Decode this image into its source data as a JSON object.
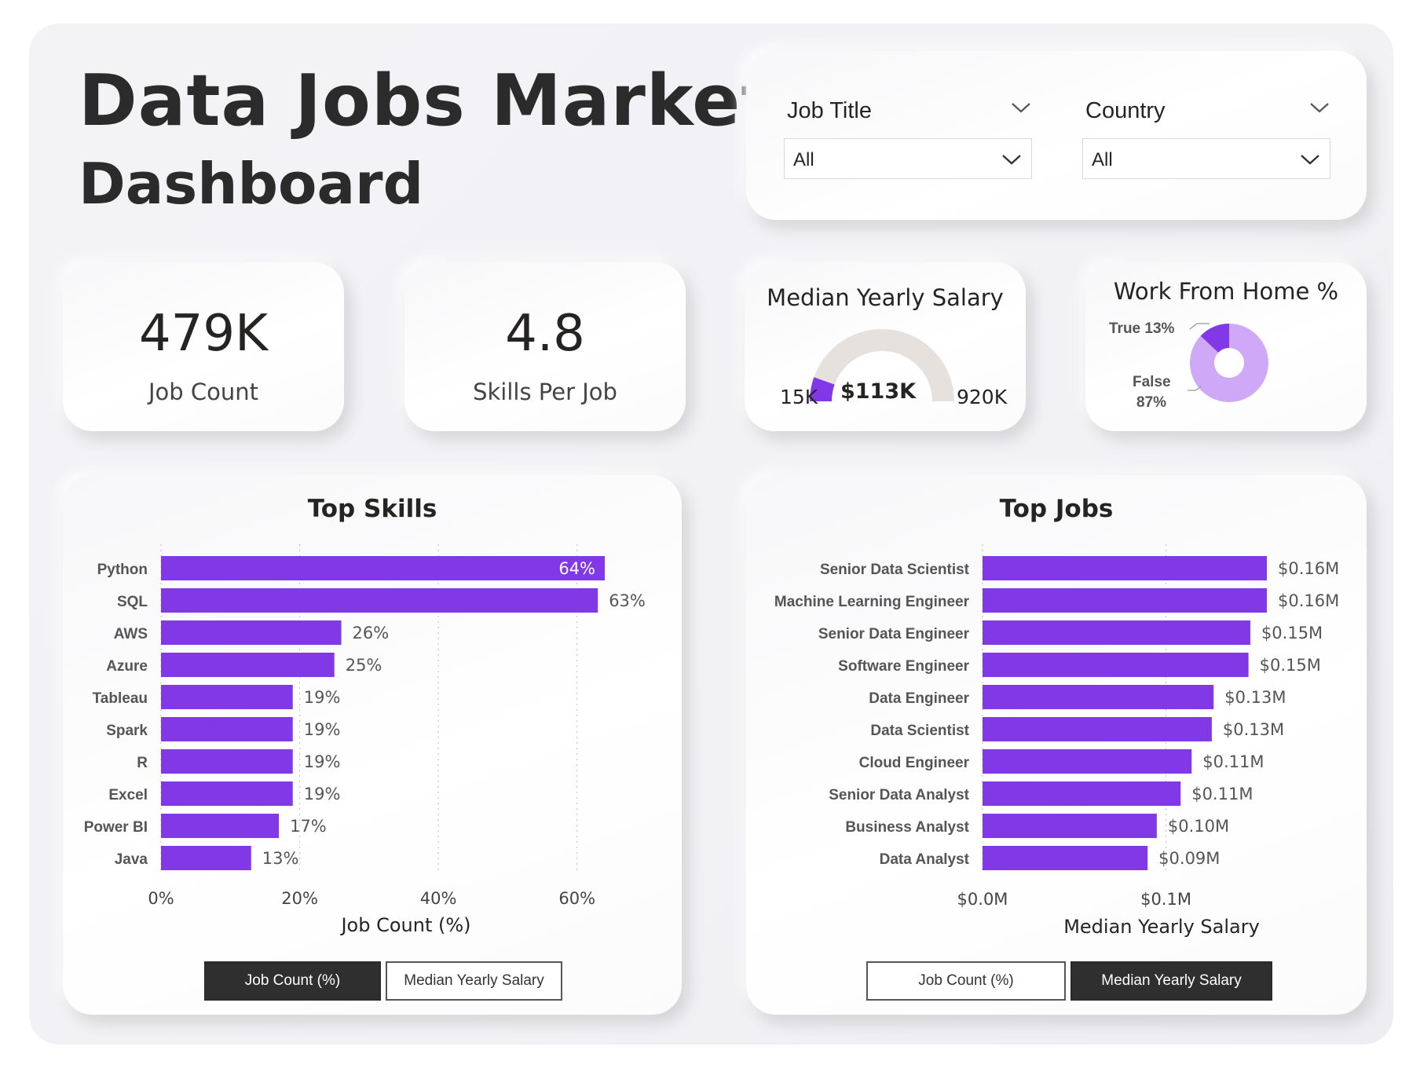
{
  "header": {
    "title_line1": "Data Jobs Market",
    "title_line2": "Dashboard"
  },
  "slicers": [
    {
      "label": "Job Title",
      "value": "All"
    },
    {
      "label": "Country",
      "value": "All"
    }
  ],
  "kpis": {
    "job_count": {
      "value": "479K",
      "label": "Job Count"
    },
    "skills_per_job": {
      "value": "4.8",
      "label": "Skills Per Job"
    }
  },
  "gauge": {
    "title": "Median Yearly Salary",
    "min_label": "15K",
    "max_label": "920K",
    "value_label": "$113K",
    "min": 15,
    "max": 920,
    "value": 113,
    "track_color": "#e6e1dd",
    "fill_color": "#8139e8"
  },
  "wfh": {
    "title": "Work From Home %",
    "true_label": "True 13%",
    "false_label_1": "False",
    "false_label_2": "87%",
    "true_pct": 13,
    "false_pct": 87,
    "true_color": "#8139e8",
    "false_color": "#cfa9f7"
  },
  "colors": {
    "bar": "#8139e8",
    "grid": "#c8c8c8",
    "text": "#252423"
  },
  "top_skills": {
    "title": "Top Skills",
    "toggle_on": "Job Count (%)",
    "toggle_off": "Median Yearly Salary",
    "chart_data": {
      "type": "bar",
      "orientation": "horizontal",
      "categories": [
        "Python",
        "SQL",
        "AWS",
        "Azure",
        "Tableau",
        "Spark",
        "R",
        "Excel",
        "Power BI",
        "Java"
      ],
      "values": [
        64,
        63,
        26,
        25,
        19,
        19,
        19,
        19,
        17,
        13
      ],
      "value_labels": [
        "64%",
        "63%",
        "26%",
        "25%",
        "19%",
        "19%",
        "19%",
        "19%",
        "17%",
        "13%"
      ],
      "xlabel": "Job Count (%)",
      "xlim": [
        0,
        70
      ],
      "xticks": [
        0,
        20,
        40,
        60
      ],
      "xtick_labels": [
        "0%",
        "20%",
        "40%",
        "60%"
      ],
      "grid": true
    }
  },
  "top_jobs": {
    "title": "Top Jobs",
    "toggle_off": "Job Count (%)",
    "toggle_on": "Median Yearly Salary",
    "chart_data": {
      "type": "bar",
      "orientation": "horizontal",
      "categories": [
        "Senior Data Scientist",
        "Machine Learning Engineer",
        "Senior Data Engineer",
        "Software Engineer",
        "Data Engineer",
        "Data Scientist",
        "Cloud Engineer",
        "Senior Data Analyst",
        "Business Analyst",
        "Data Analyst"
      ],
      "values": [
        0.155,
        0.155,
        0.146,
        0.145,
        0.126,
        0.125,
        0.114,
        0.108,
        0.095,
        0.09
      ],
      "value_labels": [
        "$0.16M",
        "$0.16M",
        "$0.15M",
        "$0.15M",
        "$0.13M",
        "$0.13M",
        "$0.11M",
        "$0.11M",
        "$0.10M",
        "$0.09M"
      ],
      "xlabel": "Median Yearly Salary",
      "xlim": [
        0,
        0.17
      ],
      "xticks": [
        0,
        0.1
      ],
      "xtick_labels": [
        "$0.0M",
        "$0.1M"
      ],
      "grid": true
    }
  }
}
